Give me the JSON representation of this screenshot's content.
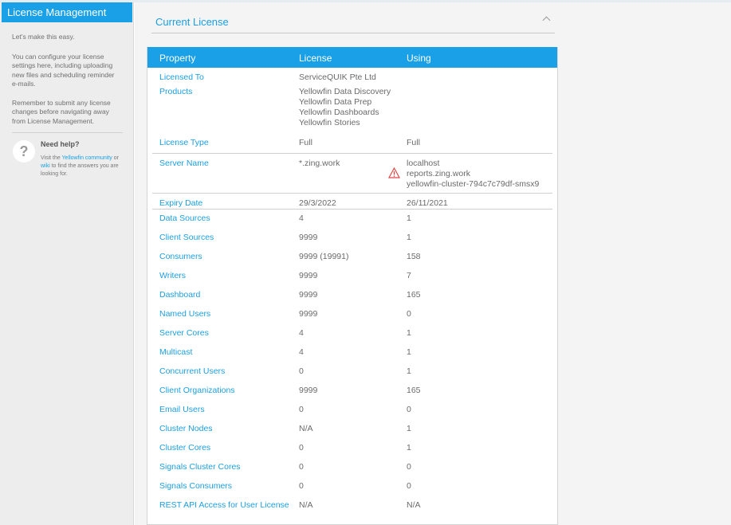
{
  "sidebar": {
    "title": "License Management",
    "intro": "Let's make this easy.",
    "paragraph1": "You can configure your license settings here, including uploading new files and scheduling reminder e-mails.",
    "paragraph2": "Remember to submit any license changes before navigating away from License Management.",
    "help": {
      "icon": "?",
      "title": "Need help?",
      "pre": "Visit the ",
      "link1": "Yellowfin community",
      "mid": " or ",
      "link2": "wiki",
      "post": " to find the answers you are looking for."
    }
  },
  "section": {
    "title": "Current License"
  },
  "table": {
    "headers": {
      "property": "Property",
      "license": "License",
      "using": "Using"
    },
    "rows": [
      {
        "property": "Licensed To",
        "license": "ServiceQUIK Pte Ltd",
        "using": ""
      },
      {
        "property": "Products",
        "license": [
          "Yellowfin Data Discovery",
          "Yellowfin Data Prep",
          "Yellowfin Dashboards",
          "Yellowfin Stories"
        ],
        "using": ""
      },
      {
        "property": "License Type",
        "license": "Full",
        "using": "Full"
      },
      {
        "property": "Server Name",
        "license": "*.zing.work",
        "using": [
          "localhost",
          "reports.zing.work",
          "yellowfin-cluster-794c7c79df-smsx9"
        ],
        "warning": true
      },
      {
        "property": "Expiry Date",
        "license": "29/3/2022",
        "using": "26/11/2021"
      },
      {
        "property": "Data Sources",
        "license": "4",
        "using": "1"
      },
      {
        "property": "Client Sources",
        "license": "9999",
        "using": "1"
      },
      {
        "property": "Consumers",
        "license": "9999 (19991)",
        "using": "158"
      },
      {
        "property": "Writers",
        "license": "9999",
        "using": "7"
      },
      {
        "property": "Dashboard",
        "license": "9999",
        "using": "165"
      },
      {
        "property": "Named Users",
        "license": "9999",
        "using": "0"
      },
      {
        "property": "Server Cores",
        "license": "4",
        "using": "1"
      },
      {
        "property": "Multicast",
        "license": "4",
        "using": "1"
      },
      {
        "property": "Concurrent Users",
        "license": "0",
        "using": "1"
      },
      {
        "property": "Client Organizations",
        "license": "9999",
        "using": "165"
      },
      {
        "property": "Email Users",
        "license": "0",
        "using": "0"
      },
      {
        "property": "Cluster Nodes",
        "license": "N/A",
        "using": "1"
      },
      {
        "property": "Cluster Cores",
        "license": "0",
        "using": "1"
      },
      {
        "property": "Signals Cluster Cores",
        "license": "0",
        "using": "0"
      },
      {
        "property": "Signals Consumers",
        "license": "0",
        "using": "0"
      },
      {
        "property": "REST API Access for User License",
        "license": "N/A",
        "using": "N/A"
      }
    ]
  },
  "icons": {
    "help": "question-icon",
    "warning": "warning-triangle-icon",
    "collapse": "chevron-up-icon"
  },
  "colors": {
    "accent": "#1aa0e6",
    "link": "#1a9fe0",
    "warning": "#e04848"
  }
}
